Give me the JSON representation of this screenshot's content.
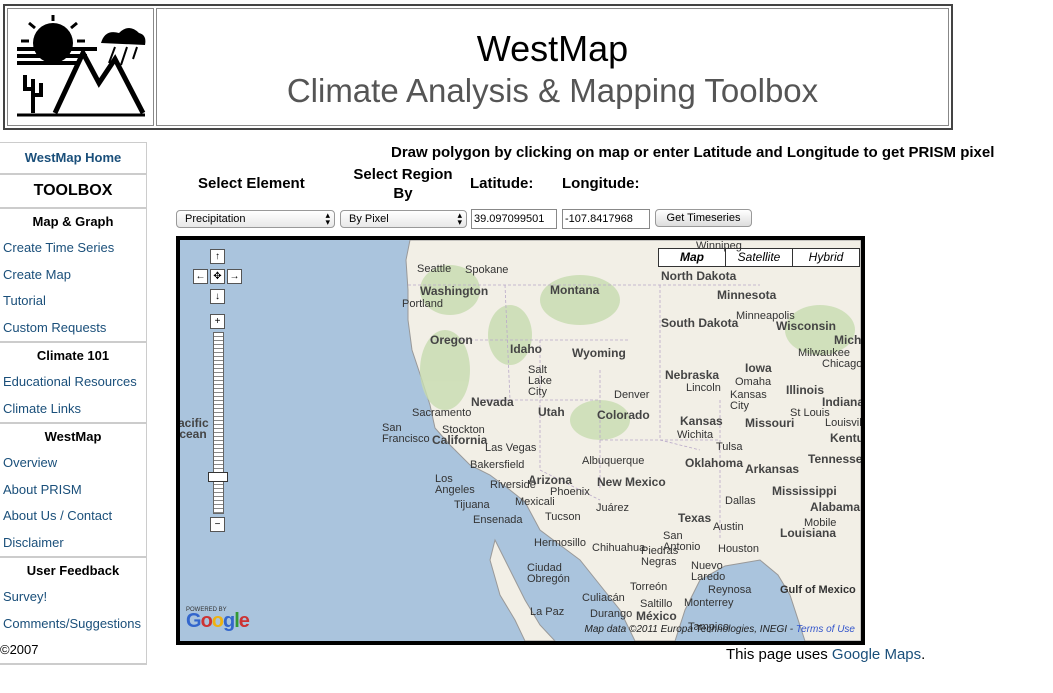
{
  "header": {
    "title": "WestMap",
    "subtitle": "Climate Analysis & Mapping Toolbox"
  },
  "sidebar": {
    "home": "WestMap Home",
    "toolbox": "TOOLBOX",
    "sections": [
      {
        "heading": "Map & Graph",
        "items": [
          "Create Time Series",
          "Create Map",
          "Tutorial",
          "Custom Requests"
        ]
      },
      {
        "heading": "Climate 101",
        "items": [
          "Educational Resources",
          "Climate Links"
        ]
      },
      {
        "heading": "WestMap",
        "items": [
          "Overview",
          "About PRISM",
          "About Us / Contact",
          "Disclaimer"
        ]
      },
      {
        "heading": "User Feedback",
        "items": [
          "Survey!",
          "Comments/Suggestions"
        ]
      }
    ],
    "copyright": "©2007"
  },
  "controls": {
    "instructions": "Draw polygon by clicking on map or enter Latitude and Longitude to get PRISM pixel",
    "element_label": "Select Element",
    "region_label_1": "Select Region",
    "region_label_2": "By",
    "lat_label": "Latitude:",
    "lon_label": "Longitude:",
    "element_value": "Precipitation",
    "region_value": "By Pixel",
    "lat_value": "39.097099501",
    "lon_value": "-107.8417968",
    "timeseries_button": "Get Timeseries"
  },
  "map": {
    "types": [
      "Map",
      "Satellite",
      "Hybrid"
    ],
    "active_type": "Map",
    "powered_by": "POWERED BY",
    "google": "Google",
    "attribution": "Map data ©2011 Europa Technologies, INEGI - ",
    "terms": "Terms of Use",
    "states": [
      "Washington",
      "Oregon",
      "Idaho",
      "Montana",
      "Wyoming",
      "Nevada",
      "Utah",
      "Colorado",
      "California",
      "Arizona",
      "New Mexico",
      "North Dakota",
      "South Dakota",
      "Nebraska",
      "Kansas",
      "Oklahoma",
      "Texas",
      "Minnesota",
      "Iowa",
      "Missouri",
      "Arkansas",
      "Louisiana",
      "Wisconsin",
      "Illinois",
      "Mississippi",
      "Alabama",
      "Tennessee",
      "Kentu",
      "Indiana",
      "Michi",
      "Gulf of Mexico",
      "Pacific Ocean"
    ],
    "cities": [
      "Spokane",
      "Seattle",
      "Portland",
      "Salt Lake City",
      "Denver",
      "Sacramento",
      "San Francisco",
      "Stockton",
      "Las Vegas",
      "Bakersfield",
      "Los Angeles",
      "Riverside",
      "Tijuana",
      "Mexicali",
      "Ensenada",
      "Phoenix",
      "Tucson",
      "Albuquerque",
      "Juárez",
      "Chihuahua",
      "Hermosillo",
      "Ciudad Obregón",
      "Culiacán",
      "La Paz",
      "Durango",
      "Torreón",
      "Saltillo",
      "Monterrey",
      "Reynosa",
      "Piedras Negras",
      "Nuevo Laredo",
      "San Antonio",
      "Austin",
      "Houston",
      "Dallas",
      "Tulsa",
      "Wichita",
      "Kansas City",
      "Omaha",
      "Lincoln",
      "Minneapolis",
      "Milwaukee",
      "Chicago",
      "St Louis",
      "Louisville",
      "Mobile",
      "México",
      "Tampico",
      "Winnipeg"
    ]
  },
  "footer": {
    "prefix": "This page uses ",
    "link": "Google Maps",
    "suffix": "."
  }
}
